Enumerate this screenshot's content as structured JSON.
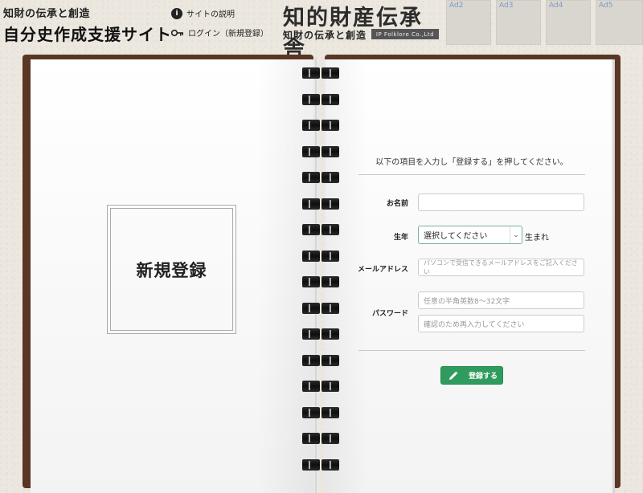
{
  "header": {
    "site_subtitle": "知財の伝承と創造",
    "site_title": "自分史作成支援サイト",
    "nav": [
      {
        "label": "サイトの説明",
        "icon": "info-circle-icon"
      },
      {
        "label": "ログイン（新規登録）",
        "icon": "key-icon"
      }
    ],
    "logo": {
      "title": "知的財産伝承舎",
      "subtitle": "知財の伝承と創造",
      "badge": "IP Folklore Co.,Ltd"
    },
    "ads": [
      "Ad2",
      "Ad3",
      "Ad4",
      "Ad5"
    ]
  },
  "left_page": {
    "heading": "新規登録"
  },
  "form": {
    "instruction": "以下の項目を入力し「登録する」を押してください。",
    "name_label": "お名前",
    "name_value": "",
    "birth_label": "生年",
    "birth_selected": "選択してください",
    "birth_suffix": "生まれ",
    "email_label": "メールアドレス",
    "email_placeholder": "パソコンで受信できるメールアドレスをご記入ください",
    "password_label": "パスワード",
    "password_placeholder": "任意の半角英数8～32文字",
    "password_confirm_placeholder": "確認のため再入力してください",
    "submit_label": "登録する",
    "submit_icon": "pencil-icon",
    "accent_color": "#2f9b5e"
  }
}
